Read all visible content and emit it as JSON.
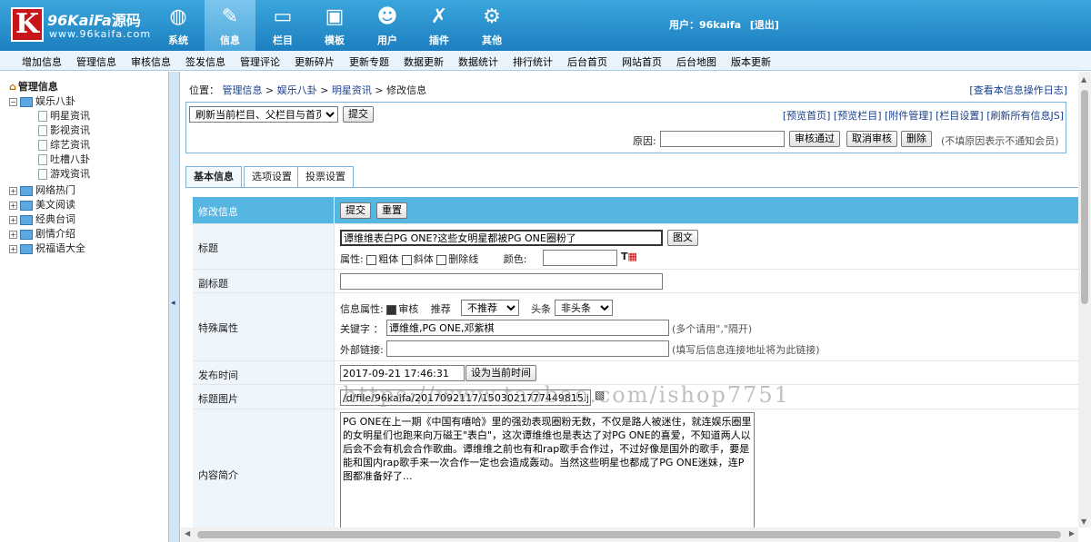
{
  "header": {
    "logo_brand": "96KaiFa",
    "logo_brand_cn": "源码",
    "logo_url": "www.96kaifa.com",
    "logo_letter": "K",
    "nav": [
      {
        "label": "系统",
        "icon": "globe-icon",
        "glyph": "◍"
      },
      {
        "label": "信息",
        "icon": "edit-document-icon",
        "glyph": "✎"
      },
      {
        "label": "栏目",
        "icon": "folder-icon",
        "glyph": "▭"
      },
      {
        "label": "模板",
        "icon": "template-window-icon",
        "glyph": "▣"
      },
      {
        "label": "用户",
        "icon": "user-icon",
        "glyph": "☻"
      },
      {
        "label": "插件",
        "icon": "plugin-tools-icon",
        "glyph": "✗"
      },
      {
        "label": "其他",
        "icon": "gear-icon",
        "glyph": "⚙"
      }
    ],
    "user_label": "用户：96kaifa",
    "logout_label": "[退出]"
  },
  "menubar": [
    "增加信息",
    "管理信息",
    "审核信息",
    "签发信息",
    "管理评论",
    "更新碎片",
    "更新专题",
    "数据更新",
    "数据统计",
    "排行统计",
    "后台首页",
    "网站首页",
    "后台地图",
    "版本更新"
  ],
  "sidebar": {
    "root": "管理信息",
    "items": [
      {
        "label": "娱乐八卦",
        "expanded": true,
        "children": [
          "明星资讯",
          "影视资讯",
          "综艺资讯",
          "吐槽八卦",
          "游戏资讯"
        ]
      },
      {
        "label": "网络热门"
      },
      {
        "label": "美文阅读"
      },
      {
        "label": "经典台词"
      },
      {
        "label": "剧情介绍"
      },
      {
        "label": "祝福语大全"
      }
    ]
  },
  "breadcrumb": {
    "prefix": "位置：",
    "links": [
      "管理信息",
      "娱乐八卦",
      "明星资讯"
    ],
    "current": "修改信息",
    "sep": " > "
  },
  "log_link": "[查看本信息操作日志]",
  "ops": {
    "refresh_select": "刷新当前栏目、父栏目与首页",
    "submit": "提交",
    "links": [
      "[预览首页]",
      "[预览栏目]",
      "[附件管理]",
      "[栏目设置]",
      "[刷新所有信息JS]"
    ],
    "reason_label": "原因:",
    "reason_value": "",
    "approve": "审核通过",
    "unapprove": "取消审核",
    "delete": "删除",
    "reason_hint": "(不填原因表示不通知会员)"
  },
  "tabs": [
    "基本信息",
    "选项设置",
    "投票设置"
  ],
  "form": {
    "header_label": "修改信息",
    "header_submit": "提交",
    "header_reset": "重置",
    "title_label": "标题",
    "title_value": "谭维维表白PG ONE?这些女明星都被PG ONE圈粉了",
    "title_image_btn": "图文",
    "attr_label": "属性:",
    "bold": "粗体",
    "italic": "斜体",
    "strike": "删除线",
    "color_label": "颜色:",
    "color_value": "",
    "subtitle_label": "副标题",
    "subtitle_value": "",
    "special_label": "特殊属性",
    "info_attr_label": "信息属性:",
    "audit_label": "审核",
    "audit_checked": true,
    "recommend_label": "推荐",
    "recommend_value": "不推荐",
    "headline_label": "头条",
    "headline_value": "非头条",
    "keywords_label": "关键字 ：",
    "keywords_value": "谭维维,PG ONE,邓紫棋",
    "keywords_hint": "(多个请用\",\"隔开)",
    "external_label": "外部链接:",
    "external_value": "",
    "external_hint": "(填写后信息连接地址将为此链接)",
    "pubtime_label": "发布时间",
    "pubtime_value": "2017-09-21 17:46:31",
    "pubtime_btn": "设为当前时间",
    "titlepic_label": "标题图片",
    "titlepic_value": "/d/file/96kaifa/2017092117/1503021777449815.jpg",
    "summary_label": "内容简介",
    "summary_value": "PG ONE在上一期《中国有嘻哈》里的强劲表现圈粉无数，不仅是路人被迷住，就连娱乐圈里的女明星们也跑来向万磁王\"表白\"，这次谭维维也是表达了对PG ONE的喜爱，不知道两人以后会不会有机会合作歌曲。谭维维之前也有和rap歌手合作过，不过好像是国外的歌手，要是能和国内rap歌手来一次合作一定也会造成轰动。当然这些明星也都成了PG ONE迷妹，连P图都准备好了..."
  },
  "watermark": "https://www.taobao.com/ishop7751",
  "colors": {
    "header_blue": "#2a90d0",
    "accent_blue": "#56b6e2",
    "logo_red": "#c8151a"
  }
}
